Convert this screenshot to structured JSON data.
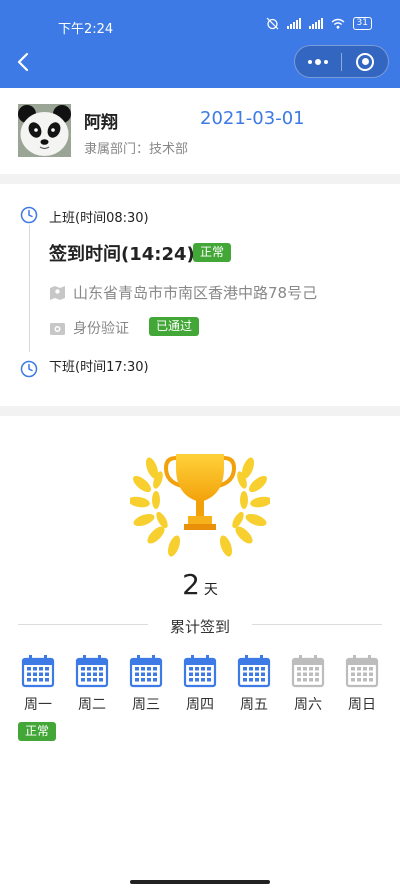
{
  "status_bar": {
    "time": "下午2:24",
    "battery": "31"
  },
  "colors": {
    "accent": "#3d7ae5",
    "success": "#43a738",
    "inactive": "#bdbdbd"
  },
  "profile": {
    "name": "阿翔",
    "department": "隶属部门：技术部",
    "date": "2021-03-01"
  },
  "attendance": {
    "start_label": "上班(时间08:30)",
    "checkin_time": "签到时间(14:24)",
    "checkin_status": "正常",
    "address": "山东省青岛市市南区香港中路78号己",
    "verify_label": "身份验证",
    "verify_status": "已通过",
    "end_label": "下班(时间17:30)"
  },
  "summary": {
    "days": "2",
    "days_unit": "天",
    "total_label": "累计签到",
    "week": [
      {
        "label": "周一",
        "active": true
      },
      {
        "label": "周二",
        "active": true
      },
      {
        "label": "周三",
        "active": true
      },
      {
        "label": "周四",
        "active": true
      },
      {
        "label": "周五",
        "active": true
      },
      {
        "label": "周六",
        "active": false
      },
      {
        "label": "周日",
        "active": false
      }
    ],
    "week_status": "正常"
  }
}
